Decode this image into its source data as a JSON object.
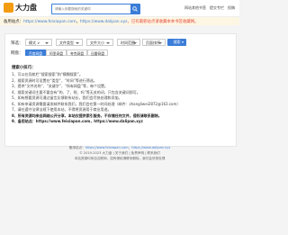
{
  "header": {
    "logo_text": "大力盘",
    "search_placeholder": "请输入你要搜索的关键词",
    "links": [
      "网站其他书签",
      "提交专栏",
      "投稿"
    ]
  },
  "notice": {
    "prefix": "备用站点：",
    "url1": "https://www.feixiapan.com",
    "sep": "，",
    "url2": "https://www.dalipan.xyz",
    "suffix": "，已有最新站点请收藏本本书签收藏网。"
  },
  "filters": {
    "label": "筛选：",
    "selects": [
      "模式 ∨",
      "文件类型",
      "文件大小",
      "时间范围",
      "页面排序"
    ],
    "button": "搜索"
  },
  "netdisk": {
    "label": "网盘：",
    "items": [
      "百度网盘",
      "阿里网盘",
      "夸克网盘",
      "迅雷网盘"
    ],
    "active_index": 0
  },
  "tips": {
    "title": "搜索小技巧：",
    "items": [
      "1、可以在导航栏“搜索搜索”和“模糊搜索”。",
      "2、搜索资源时可设置在“类型”、“时间”等进行筛选。",
      "3、提供“文件名称”、“关键字”、“所有网盘”等，每个设置。",
      "4、搜索关键词主要不要含有“的、了、呢、吗”等无关的词，只包含关键词即可。",
      "5、如有想要资源可通过留言反馈联系站长，我们会尽快处理和添加。",
      "6、如有申请资源需要请发邮件联系我们，我们会在第一时间处理（邮件：zhangliwei2872@163.com）",
      "7、请在遵守法律法规下使用本站，不得将资源用于商业用途。",
      "8、所有资源均来自网络公开分享，本站仅提供索引服务，不存储任何文件，侵权请联系删除。",
      "9、备用站点：https://www.feixiapan.com，https://www.dalipan.xyz"
    ]
  },
  "footer": {
    "line1_prefix": "备用站点：",
    "line1_url1": "https://www.feixiapan.com",
    "line1_sep": "，",
    "line1_url2": "https://www.dalipan.xyz",
    "line2": "© 2019-2023 大力盘  |  关于我们  |  免责声明  |  联系我们",
    "line3": "本站资源均来自互联网，如有侵权请联系删除，我们会尽快处理"
  }
}
